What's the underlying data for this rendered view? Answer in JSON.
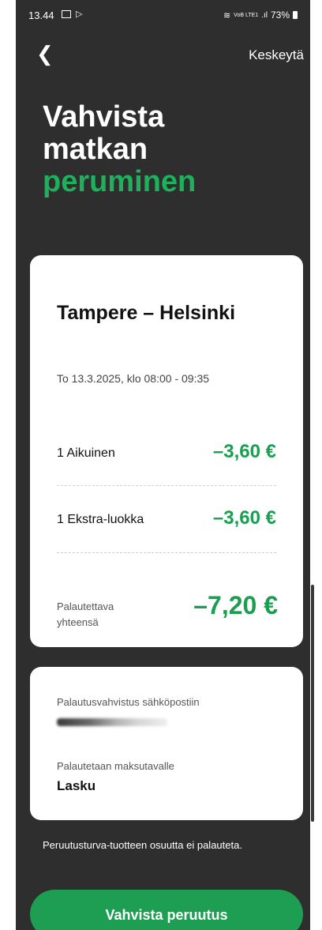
{
  "status_bar": {
    "time": "13.44",
    "network": "VoB LTE1",
    "battery": "73%"
  },
  "header": {
    "back_icon": "chevron-left-icon",
    "cancel_label": "Keskeytä"
  },
  "title": {
    "line1": "Vahvista",
    "line2": "matkan",
    "line3": "peruminen"
  },
  "trip": {
    "route": "Tampere – Helsinki",
    "datetime": "To 13.3.2025, klo 08:00 - 09:35",
    "items": [
      {
        "label": "1 Aikuinen",
        "amount": "–3,60 €"
      },
      {
        "label": "1 Ekstra-luokka",
        "amount": "–3,60 €"
      }
    ],
    "total_label": "Palautettava yhteensä",
    "total_amount": "–7,20 €"
  },
  "refund": {
    "email_label": "Palautusvahvistus sähköpostiin",
    "method_label": "Palautetaan maksutavalle",
    "method_value": "Lasku"
  },
  "note": "Peruutusturva-tuotteen osuutta ei palauteta.",
  "confirm_label": "Vahvista peruutus",
  "colors": {
    "accent": "#1eb15c",
    "button": "#1e9e52",
    "background": "#2e2e2e"
  }
}
